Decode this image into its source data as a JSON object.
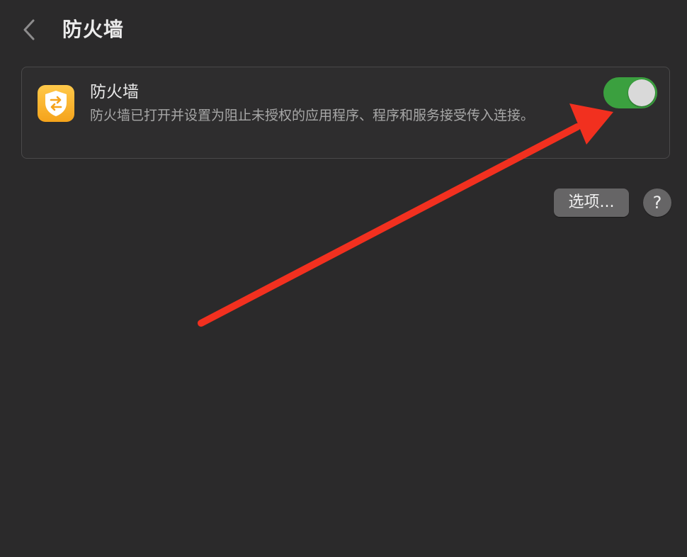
{
  "header": {
    "title": "防火墙",
    "back_icon": "chevron-left-icon"
  },
  "firewall_card": {
    "icon": "shield-arrows-icon",
    "title": "防火墙",
    "description": "防火墙已打开并设置为阻止未授权的应用程序、程序和服务接受传入连接。",
    "toggle_on": true
  },
  "actions": {
    "options_label": "选项...",
    "help_label": "?"
  },
  "colors": {
    "background": "#2b2a2b",
    "toggle_on": "#3ba03f",
    "icon_orange": "#f5a31b",
    "annotation_red": "#f2301f"
  }
}
